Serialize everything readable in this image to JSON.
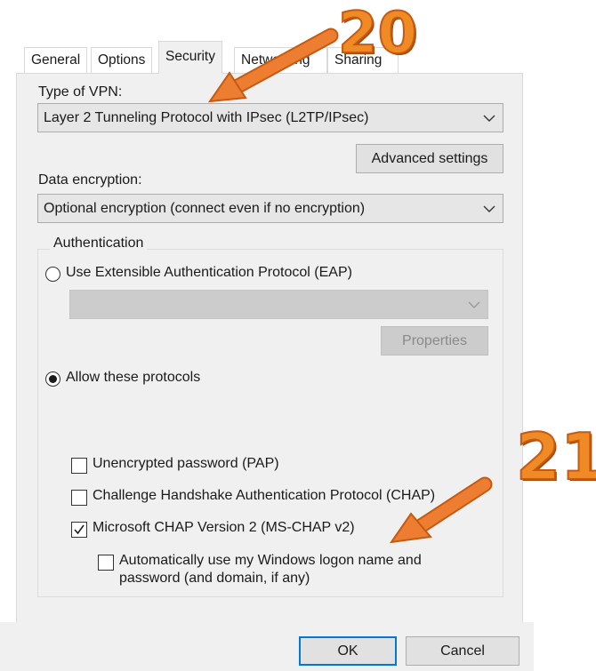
{
  "tabs": [
    {
      "label": "General",
      "active": false
    },
    {
      "label": "Options",
      "active": false
    },
    {
      "label": "Security",
      "active": true
    },
    {
      "label": "Networking",
      "active": false
    },
    {
      "label": "Sharing",
      "active": false
    }
  ],
  "vpn_type": {
    "label": "Type of VPN:",
    "selected": "Layer 2 Tunneling Protocol with IPsec (L2TP/IPsec)"
  },
  "advanced_settings_label": "Advanced settings",
  "data_encryption": {
    "label": "Data encryption:",
    "selected": "Optional encryption (connect even if no encryption)"
  },
  "authentication": {
    "legend": "Authentication",
    "eap_radio_label": "Use Extensible Authentication Protocol (EAP)",
    "eap_selected": false,
    "eap_combo_value": "",
    "properties_label": "Properties",
    "allow_radio_label": "Allow these protocols",
    "allow_selected": true,
    "protocols": [
      {
        "label": "Unencrypted password (PAP)",
        "checked": false
      },
      {
        "label": "Challenge Handshake Authentication Protocol (CHAP)",
        "checked": false
      },
      {
        "label": "Microsoft CHAP Version 2 (MS-CHAP v2)",
        "checked": true
      }
    ],
    "auto_logon": {
      "line1": "Automatically use my Windows logon name and",
      "line2": "password (and domain, if any)",
      "checked": false
    }
  },
  "footer": {
    "ok_label": "OK",
    "cancel_label": "Cancel"
  },
  "annotations": [
    {
      "number": "20",
      "color": "#f08a24"
    },
    {
      "number": "21",
      "color": "#f08a24"
    }
  ]
}
